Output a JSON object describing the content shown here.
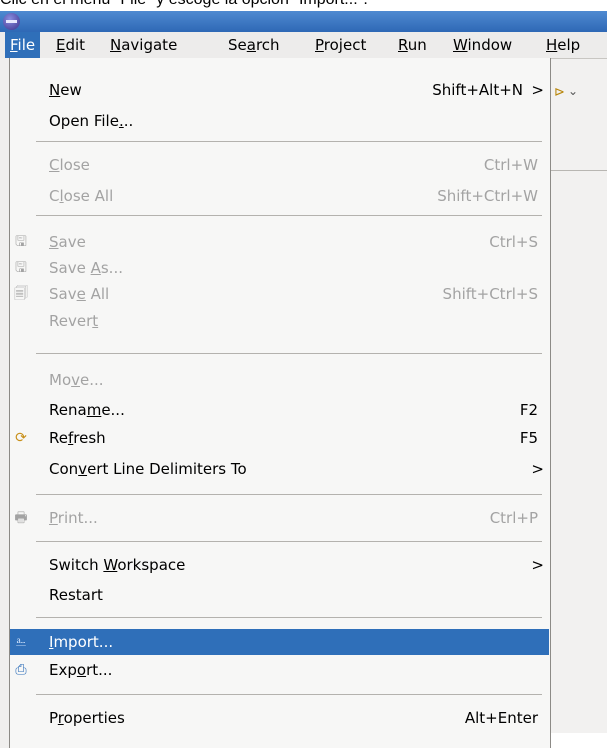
{
  "caption": "Clic en el menú \"File\" y escoge la opción \"Import...\".",
  "menubar": [
    {
      "label": "File",
      "mnemonic": "F"
    },
    {
      "label": "Edit",
      "mnemonic": "E"
    },
    {
      "label": "Navigate",
      "mnemonic": "N"
    },
    {
      "label": "Search",
      "mnemonic": "a"
    },
    {
      "label": "Project",
      "mnemonic": "P"
    },
    {
      "label": "Run",
      "mnemonic": "R"
    },
    {
      "label": "Window",
      "mnemonic": "W"
    },
    {
      "label": "Help",
      "mnemonic": "H"
    }
  ],
  "menu": [
    {
      "label": "New",
      "accel": "Shift+Alt+N",
      "submenu": true,
      "enabled": true
    },
    {
      "label": "Open File...",
      "accel": "",
      "enabled": true
    },
    {
      "label": "Close",
      "accel": "Ctrl+W",
      "enabled": false
    },
    {
      "label": "Close All",
      "accel": "Shift+Ctrl+W",
      "enabled": false
    },
    {
      "label": "Save",
      "accel": "Ctrl+S",
      "enabled": false,
      "icon": "save-icon"
    },
    {
      "label": "Save As...",
      "accel": "",
      "enabled": false,
      "icon": "save-as-icon"
    },
    {
      "label": "Save All",
      "accel": "Shift+Ctrl+S",
      "enabled": false,
      "icon": "save-all-icon"
    },
    {
      "label": "Revert",
      "accel": "",
      "enabled": false
    },
    {
      "label": "Move...",
      "accel": "",
      "enabled": false
    },
    {
      "label": "Rename...",
      "accel": "F2",
      "enabled": true
    },
    {
      "label": "Refresh",
      "accel": "F5",
      "enabled": true,
      "icon": "refresh-icon"
    },
    {
      "label": "Convert Line Delimiters To",
      "accel": "",
      "submenu": true,
      "enabled": true
    },
    {
      "label": "Print...",
      "accel": "Ctrl+P",
      "enabled": false,
      "icon": "print-icon"
    },
    {
      "label": "Switch Workspace",
      "accel": "",
      "submenu": true,
      "enabled": true
    },
    {
      "label": "Restart",
      "accel": "",
      "enabled": true
    },
    {
      "label": "Import...",
      "accel": "",
      "enabled": true,
      "highlighted": true,
      "icon": "import-icon"
    },
    {
      "label": "Export...",
      "accel": "",
      "enabled": true,
      "icon": "export-icon"
    },
    {
      "label": "Properties",
      "accel": "Alt+Enter",
      "enabled": true
    }
  ],
  "arrow_glyph": ">"
}
